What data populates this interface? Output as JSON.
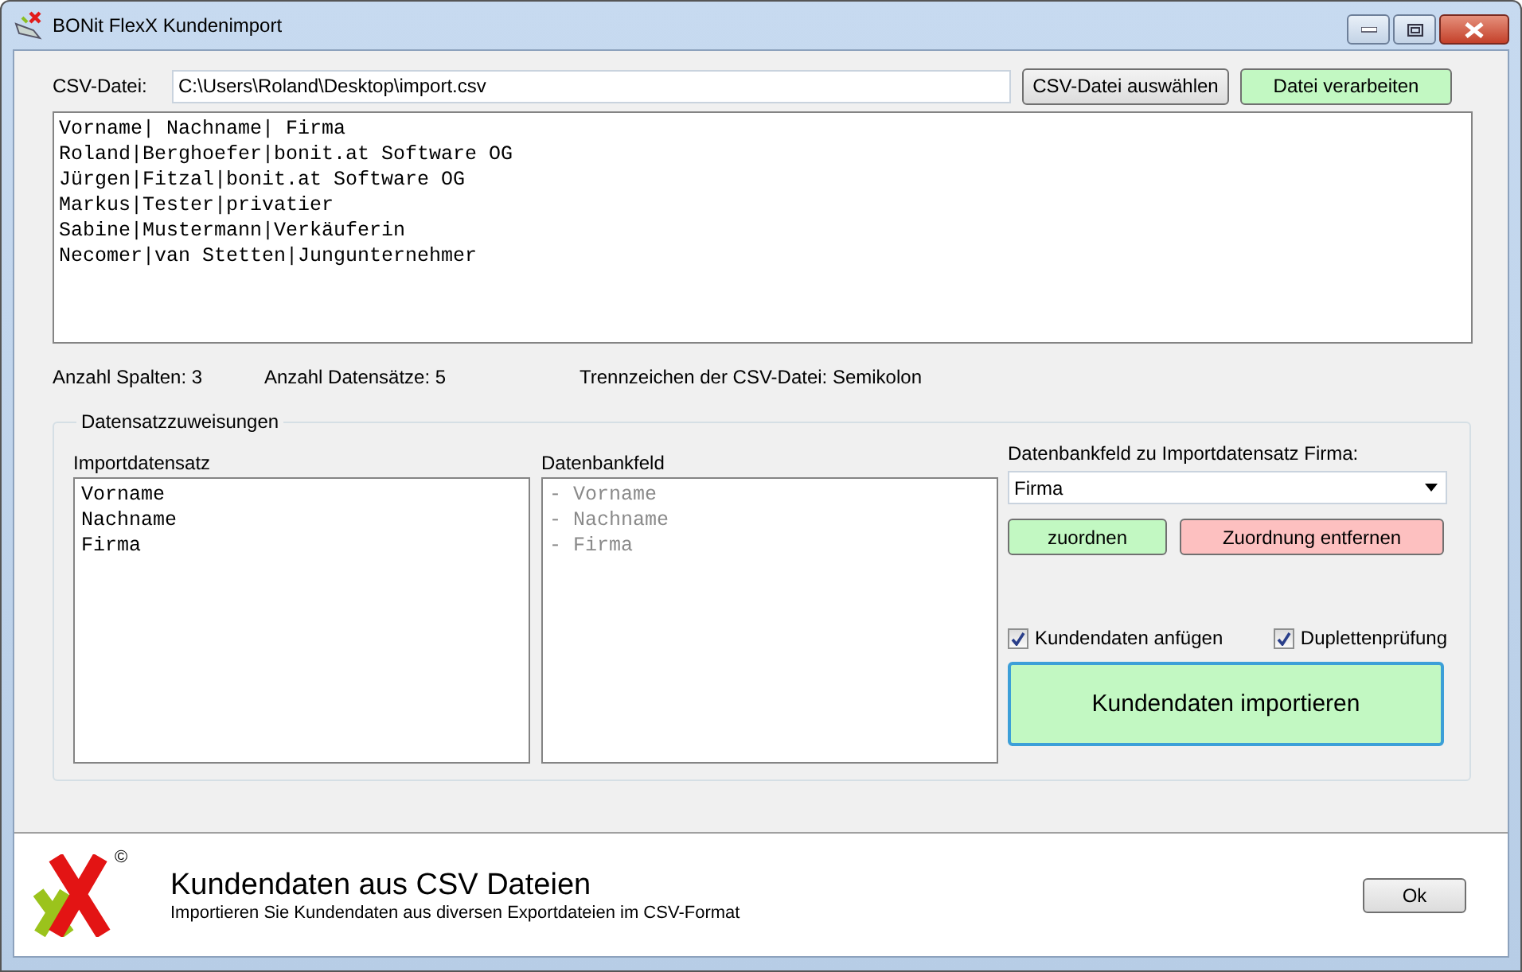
{
  "window": {
    "title": "BONit FlexX Kundenimport"
  },
  "file": {
    "label": "CSV-Datei:",
    "value": "C:\\Users\\Roland\\Desktop\\import.csv"
  },
  "file_buttons": [
    {
      "label": "CSV-Datei auswählen",
      "kind": "plain"
    },
    {
      "label": "Datei verarbeiten",
      "kind": "green"
    }
  ],
  "preview_lines": [
    "Vorname| Nachname| Firma",
    "Roland|Berghoefer|bonit.at Software OG",
    "Jürgen|Fitzal|bonit.at Software OG",
    "Markus|Tester|privatier",
    "Sabine|Mustermann|Verkäuferin",
    "Necomer|van Stetten|Jungunternehmer"
  ],
  "stats": [
    "Anzahl Spalten: 3",
    "Anzahl Datensätze: 5",
    "Trennzeichen der CSV-Datei: Semikolon"
  ],
  "group": {
    "title": "Datensatzzuweisungen",
    "lists": [
      {
        "label": "Importdatensatz",
        "muted": false,
        "items": [
          "Vorname",
          "Nachname",
          "Firma"
        ]
      },
      {
        "label": "Datenbankfeld",
        "muted": true,
        "items": [
          "- Vorname",
          "- Nachname",
          "- Firma"
        ]
      }
    ],
    "mapping_label": "Datenbankfeld zu Importdatensatz Firma:",
    "mapping_value": "Firma",
    "mapping_buttons": [
      {
        "label": "zuordnen",
        "kind": "green"
      },
      {
        "label": "Zuordnung entfernen",
        "kind": "red"
      }
    ],
    "checkboxes": [
      {
        "label": "Kundendaten anfügen",
        "checked": true
      },
      {
        "label": "Duplettenprüfung",
        "checked": true
      }
    ],
    "import_button": "Kundendaten importieren"
  },
  "footer": {
    "logo_mark": "©",
    "title": "Kundendaten aus CSV Dateien",
    "subtitle": "Importieren Sie Kundendaten aus diversen Exportdateien im CSV-Format",
    "ok_button": "Ok"
  }
}
